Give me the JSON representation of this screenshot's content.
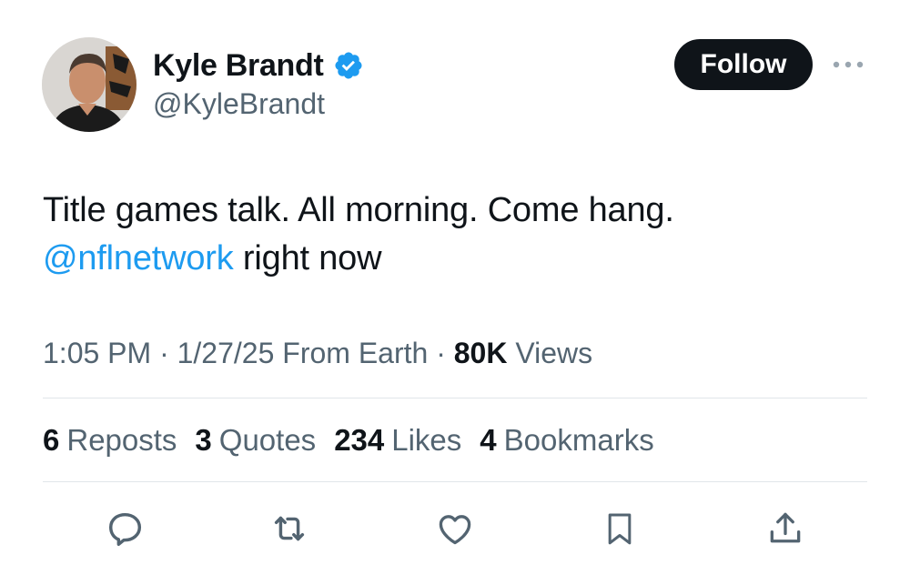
{
  "author": {
    "display_name": "Kyle Brandt",
    "handle": "@KyleBrandt",
    "avatar_icon": "profile-photo",
    "verified_icon": "verified-badge-icon"
  },
  "header": {
    "follow_label": "Follow",
    "more_icon": "more-horizontal-icon"
  },
  "tweet": {
    "line1": "Title games talk. All morning. Come hang.",
    "mention": "@nflnetwork",
    "line2_rest": " right now"
  },
  "meta": {
    "time": "1:05 PM",
    "sep1": " · ",
    "date": "1/27/25",
    "source": " From Earth",
    "sep2": " · ",
    "views_count": "80K",
    "views_label": " Views"
  },
  "stats": {
    "reposts_count": "6",
    "reposts_label": "Reposts",
    "quotes_count": "3",
    "quotes_label": "Quotes",
    "likes_count": "234",
    "likes_label": "Likes",
    "bookmarks_count": "4",
    "bookmarks_label": "Bookmarks"
  },
  "actions": [
    "reply-icon",
    "retweet-icon",
    "like-icon",
    "bookmark-icon",
    "share-icon"
  ],
  "colors": {
    "text_primary": "#0f1419",
    "text_secondary": "#536471",
    "accent": "#1d9bf0",
    "divider": "#e1e6ea",
    "follow_button_bg": "#0f1419"
  }
}
